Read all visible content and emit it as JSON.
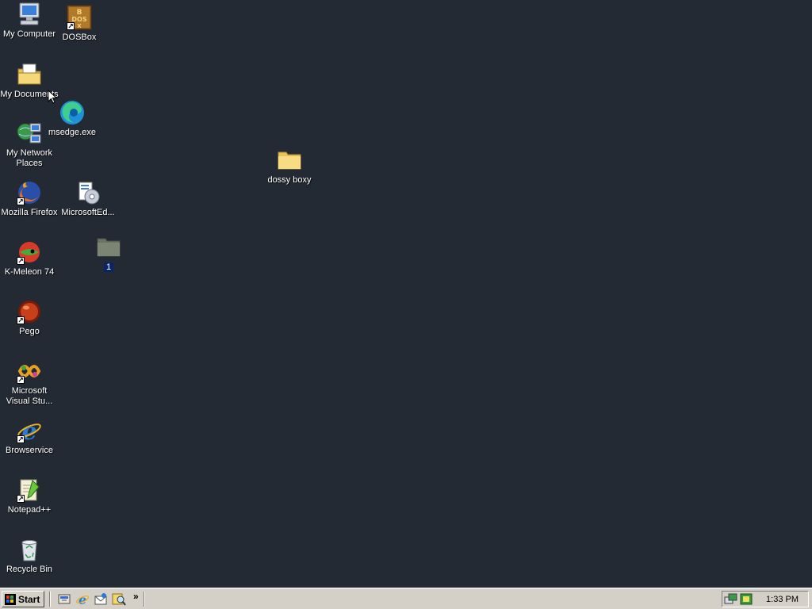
{
  "desktop": {
    "icons": [
      {
        "label": "My Computer",
        "icon": "computer-icon",
        "shortcut": false
      },
      {
        "label": "DOSBox",
        "icon": "dosbox-icon",
        "shortcut": true
      },
      {
        "label": "My Documents",
        "icon": "documents-folder-icon",
        "shortcut": false
      },
      {
        "label": "msedge.exe",
        "icon": "edge-icon",
        "shortcut": false
      },
      {
        "label": "My Network Places",
        "icon": "network-icon",
        "shortcut": false
      },
      {
        "label": "dossy boxy",
        "icon": "folder-icon",
        "shortcut": false
      },
      {
        "label": "Mozilla Firefox",
        "icon": "firefox-icon",
        "shortcut": true
      },
      {
        "label": "MicrosoftEd...",
        "icon": "installer-icon",
        "shortcut": false
      },
      {
        "label": "1",
        "icon": "folder-icon",
        "shortcut": false,
        "selected": true
      },
      {
        "label": "K-Meleon 74",
        "icon": "kmeleon-icon",
        "shortcut": true
      },
      {
        "label": "Pego",
        "icon": "pego-icon",
        "shortcut": true
      },
      {
        "label": "Microsoft Visual Stu...",
        "icon": "visual-studio-icon",
        "shortcut": true
      },
      {
        "label": "Browservice",
        "icon": "ie-icon",
        "shortcut": true
      },
      {
        "label": "Notepad++",
        "icon": "notepadpp-icon",
        "shortcut": true
      },
      {
        "label": "Recycle Bin",
        "icon": "recycle-bin-icon",
        "shortcut": false
      }
    ]
  },
  "taskbar": {
    "start_label": "Start",
    "quick_launch": [
      "show-desktop-icon",
      "ie-icon",
      "outlook-express-icon",
      "search-icon"
    ],
    "more_label": "»",
    "tray_icons": [
      "network-tray-icon",
      "security-tray-icon"
    ],
    "clock": "1:33 PM"
  },
  "colors": {
    "desktop_bg": "#242a34",
    "taskbar_bg": "#d4d0c8",
    "selection": "#0a246a",
    "folder": "#f5d87a"
  }
}
